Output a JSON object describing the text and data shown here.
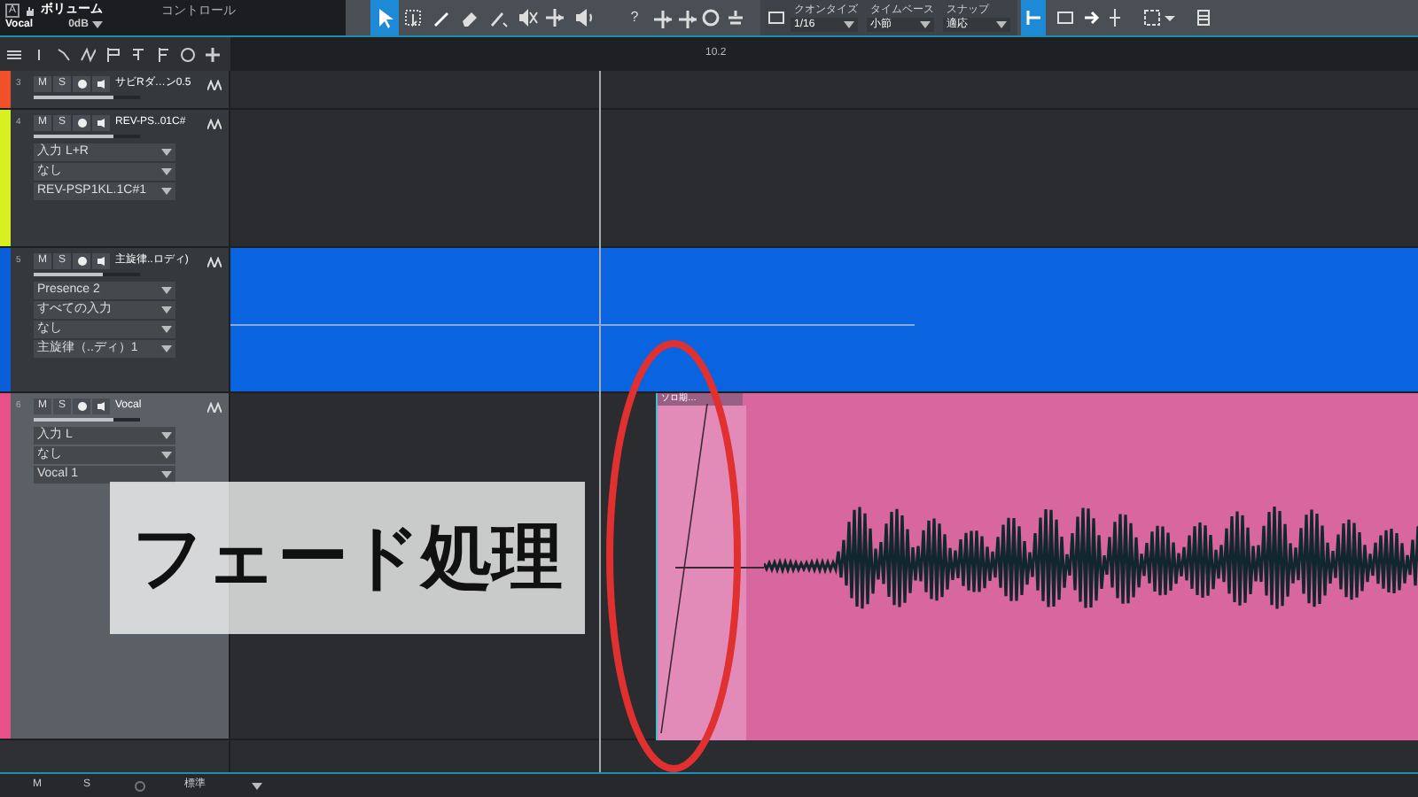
{
  "toolbar": {
    "automation_badge": "A",
    "volume_label": "ボリューム",
    "track_name": "Vocal",
    "volume_value": "0dB",
    "control_label": "コントロール",
    "tools": [
      {
        "kind": "arrow",
        "selected": true
      },
      {
        "kind": "range",
        "selected": false
      },
      {
        "kind": "pencil",
        "selected": false
      },
      {
        "kind": "eraser",
        "selected": false
      },
      {
        "kind": "paint",
        "selected": false
      },
      {
        "kind": "mute",
        "selected": false
      },
      {
        "kind": "split",
        "selected": false
      },
      {
        "kind": "speaker",
        "selected": false
      }
    ],
    "help": "?",
    "quantize": {
      "label": "クオンタイズ",
      "value": "1/16"
    },
    "timebase": {
      "label": "タイムベース",
      "value": "小節"
    },
    "snap": {
      "label": "スナップ",
      "value": "適応"
    },
    "snap_toggle": {
      "selected": true
    }
  },
  "ruler": {
    "marker": "10.2"
  },
  "tracks": [
    {
      "number": "3",
      "name": "サビRダ…ン0.5",
      "color": "#f0502a",
      "selected": false,
      "level": 0.75,
      "mute_label": "M",
      "solo_label": "S"
    },
    {
      "number": "4",
      "name": "REV-PS..01C#",
      "color": "#d8f020",
      "selected": false,
      "level": 0.75,
      "mute_label": "M",
      "solo_label": "S",
      "fields": [
        "入力 L+R",
        "なし",
        "REV-PSP1KL.1C#1"
      ]
    },
    {
      "number": "5",
      "name": "主旋律..ロディ)",
      "color": "#0a5fd8",
      "selected": false,
      "level": 0.65,
      "mute_label": "M",
      "solo_label": "S",
      "fields": [
        "Presence 2",
        "すべての入力",
        "なし",
        "主旋律（..ディ）1"
      ]
    },
    {
      "number": "6",
      "name": "Vocal",
      "color": "#e8508a",
      "selected": true,
      "level": 0.75,
      "mute_label": "M",
      "solo_label": "S",
      "fields": [
        "入力 L",
        "なし",
        "Vocal 1"
      ]
    }
  ],
  "clip": {
    "title": "ソロ期…"
  },
  "caption": "フェード処理",
  "status_bar": {
    "items": [
      "M",
      "S"
    ],
    "mode": "標準"
  }
}
